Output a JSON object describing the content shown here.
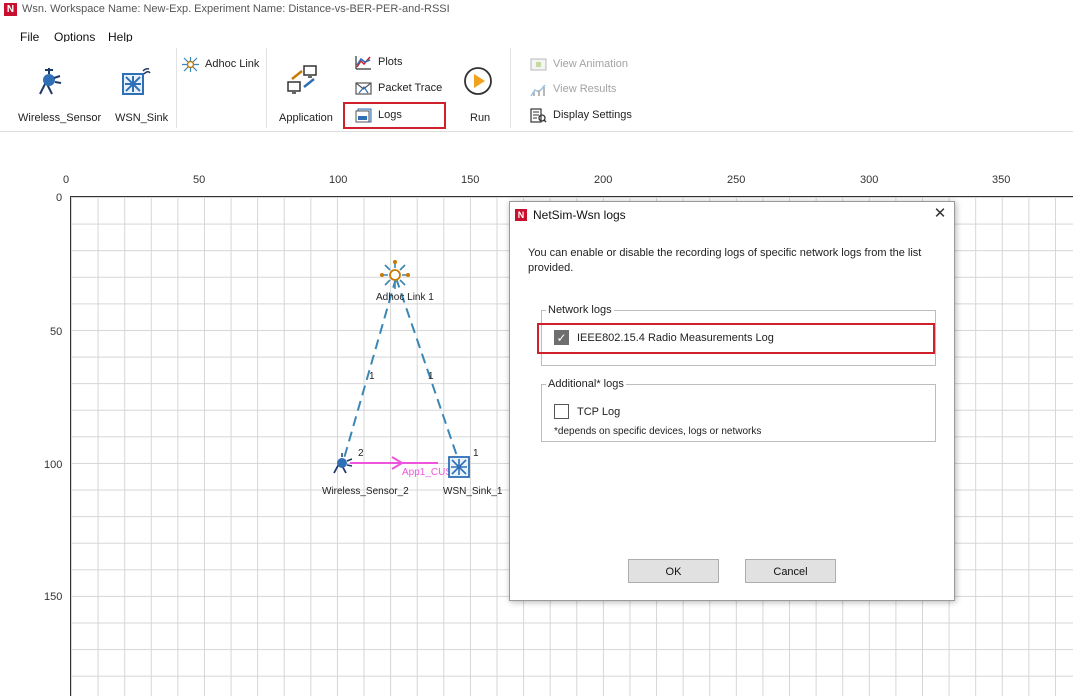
{
  "window": {
    "logo": "N",
    "title": "Wsn. Workspace Name: New-Exp. Experiment Name: Distance-vs-BER-PER-and-RSSI"
  },
  "menu": {
    "file": "File",
    "options": "Options",
    "help": "Help"
  },
  "ribbon": {
    "wireless_sensor": "Wireless_Sensor",
    "wsn_sink": "WSN_Sink",
    "adhoc_link": "Adhoc Link",
    "application": "Application",
    "plots": "Plots",
    "packet_trace": "Packet Trace",
    "logs": "Logs",
    "run": "Run",
    "view_animation": "View Animation",
    "view_results": "View Results",
    "display_settings": "Display Settings"
  },
  "ruler": {
    "x_ticks": [
      "0",
      "50",
      "100",
      "150",
      "200",
      "250",
      "300",
      "350"
    ],
    "y_ticks": [
      "0",
      "50",
      "100",
      "150"
    ]
  },
  "network": {
    "adhoc_link_label": "Adhoc Link 1",
    "sensor_label": "Wireless_Sensor_2",
    "sink_label": "WSN_Sink_1",
    "link_left_label": "1",
    "link_right_label": "1",
    "sensor_id": "2",
    "sink_id": "1",
    "app_label": "App1_CUS"
  },
  "dialog": {
    "logo": "N",
    "title": "NetSim-Wsn logs",
    "close": "✕",
    "description": "You can enable or disable the recording logs of specific network logs from the list provided.",
    "network_logs_legend": "Network logs",
    "radio_log_label": "IEEE802.15.4 Radio Measurements Log",
    "radio_log_checked": true,
    "additional_logs_legend": "Additional* logs",
    "tcp_log_label": "TCP Log",
    "tcp_log_checked": false,
    "footnote": "*depends on specific devices, logs or networks",
    "ok": "OK",
    "cancel": "Cancel"
  },
  "colors": {
    "highlight": "#d0202c",
    "link": "#3a86b5",
    "app_flow": "#ee55dd"
  }
}
